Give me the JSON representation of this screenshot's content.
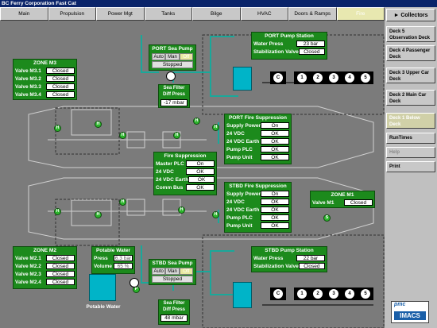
{
  "window": {
    "title": "BC Ferry Corporation Fast Cat"
  },
  "tabs": [
    "Main",
    "Propulsion",
    "Power Mgt",
    "Tanks",
    "Bilge",
    "HVAC",
    "Doors & Ramps",
    "Fire"
  ],
  "active_tab": "Fire",
  "sidebar": {
    "header": "Collectors",
    "items": [
      {
        "label": "Deck 5 Observation Deck"
      },
      {
        "label": "Deck 4 Passenger Deck"
      },
      {
        "label": "Deck 3 Upper Car Deck"
      },
      {
        "label": "Deck 2 Main Car Deck"
      },
      {
        "label": "Deck 1 Below Deck"
      },
      {
        "label": "RunTimes"
      },
      {
        "label": "Help"
      },
      {
        "label": "Print"
      }
    ],
    "logo_top": "pmc",
    "logo_bottom": "IMACS"
  },
  "zone_m3": {
    "title": "ZONE M3",
    "rows": [
      {
        "label": "Valve M3.1",
        "value": "Closed"
      },
      {
        "label": "Valve M3.2",
        "value": "Closed"
      },
      {
        "label": "Valve M3.3",
        "value": "Closed"
      },
      {
        "label": "Valve M3.4",
        "value": "Closed"
      }
    ]
  },
  "zone_m2": {
    "title": "ZONE M2",
    "rows": [
      {
        "label": "Valve M2.1",
        "value": "Closed"
      },
      {
        "label": "Valve M2.2",
        "value": "Closed"
      },
      {
        "label": "Valve M2.3",
        "value": "Closed"
      },
      {
        "label": "Valve M2.4",
        "value": "Closed"
      }
    ]
  },
  "zone_m1": {
    "title": "ZONE M1",
    "rows": [
      {
        "label": "Valve M1",
        "value": "Closed"
      }
    ]
  },
  "port_sea_pump": {
    "title": "PORT Sea Pump",
    "modes": [
      "Auto",
      "Man",
      "Off"
    ],
    "state": "Stopped",
    "filter_label": "Sea Filter Diff Press",
    "filter_value": "-17 mbar"
  },
  "stbd_sea_pump": {
    "title": "STBD Sea Pump",
    "modes": [
      "Auto",
      "Man",
      "Off"
    ],
    "state": "Stopped",
    "filter_label": "Sea Filter Diff Press",
    "filter_value": "48 mbar"
  },
  "port_pump_station": {
    "title": "PORT Pump Station",
    "rows": [
      {
        "label": "Water Press",
        "value": "23 bar"
      },
      {
        "label": "Stabilization Valve",
        "value": "Closed"
      }
    ]
  },
  "stbd_pump_station": {
    "title": "STBD Pump Station",
    "rows": [
      {
        "label": "Water Press",
        "value": "22 bar"
      },
      {
        "label": "Stabilization Valve",
        "value": "Closed"
      }
    ]
  },
  "port_fire": {
    "title": "PORT Fire Suppression",
    "rows": [
      {
        "label": "Supply Power",
        "value": "On"
      },
      {
        "label": "24 VDC",
        "value": "OK"
      },
      {
        "label": "24 VDC Earth",
        "value": "OK"
      },
      {
        "label": "Pump PLC",
        "value": "OK"
      },
      {
        "label": "Pump Unit",
        "value": "OK"
      }
    ]
  },
  "stbd_fire": {
    "title": "STBD Fire Suppression",
    "rows": [
      {
        "label": "Supply Power",
        "value": "On"
      },
      {
        "label": "24 VDC",
        "value": "OK"
      },
      {
        "label": "24 VDC Earth",
        "value": "OK"
      },
      {
        "label": "Pump PLC",
        "value": "OK"
      },
      {
        "label": "Pump Unit",
        "value": "OK"
      }
    ]
  },
  "fire_supp": {
    "title": "Fire Suppression",
    "rows": [
      {
        "label": "Master PLC",
        "value": "On"
      },
      {
        "label": "24 VDC",
        "value": "OK"
      },
      {
        "label": "24 VDC Earth",
        "value": "OK"
      },
      {
        "label": "Comm Bus",
        "value": "OK"
      }
    ]
  },
  "potable": {
    "title": "Potable Water",
    "rows": [
      {
        "label": "Press",
        "value": "6.3 bar"
      },
      {
        "label": "Volume",
        "value": "65 %"
      }
    ],
    "tank_label": "Potable Water"
  },
  "pumps": [
    "C",
    "1",
    "2",
    "3",
    "4",
    "5"
  ],
  "hydrant_letter": "H",
  "sprinkler_letter": "S",
  "pump_letter": "P",
  "colors": {
    "panel": "#1c8a1c",
    "tank": "#00b4c8",
    "pipe": "#1aa89a",
    "ok": "#ffffff"
  }
}
